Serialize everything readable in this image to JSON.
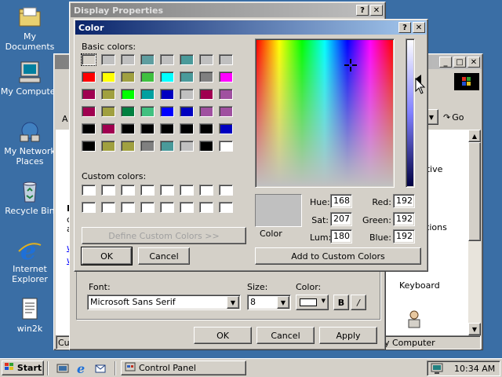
{
  "desktop": {
    "icons": [
      {
        "label": "My Documents",
        "icon": "folder-documents-icon"
      },
      {
        "label": "My Computer",
        "icon": "computer-icon"
      },
      {
        "label": "My Network Places",
        "icon": "network-places-icon"
      },
      {
        "label": "Recycle Bin",
        "icon": "recycle-bin-icon"
      },
      {
        "label": "Internet Explorer",
        "icon": "internet-explorer-icon"
      },
      {
        "label": "win2k",
        "icon": "text-document-icon"
      }
    ]
  },
  "control_panel": {
    "go_label": "Go",
    "address_prefix": "A",
    "right_items": [
      "ative",
      "ctions",
      "Keyboard"
    ],
    "status_left": "Cus",
    "status_right": "y Computer",
    "left_text": [
      "D",
      "c",
      "a",
      "w",
      "w"
    ]
  },
  "display_properties": {
    "title": "Display Properties",
    "font_label": "Font:",
    "font_value": "Microsoft Sans Serif",
    "size_label": "Size:",
    "size_value": "8",
    "color_label": "Color:",
    "bold_label": "B",
    "italic_label": "/",
    "ok_label": "OK",
    "cancel_label": "Cancel",
    "apply_label": "Apply"
  },
  "color_dialog": {
    "title": "Color",
    "basic_colors_label": "Basic colors:",
    "custom_colors_label": "Custom colors:",
    "define_custom_label": "Define Custom Colors >>",
    "ok_label": "OK",
    "cancel_label": "Cancel",
    "color_preview_label": "Color",
    "add_custom_label": "Add to Custom Colors",
    "hue_label": "Hue:",
    "sat_label": "Sat:",
    "lum_label": "Lum:",
    "red_label": "Red:",
    "green_label": "Green:",
    "blue_label": "Blue:",
    "hue_value": "168",
    "sat_value": "207",
    "lum_value": "180",
    "red_value": "192",
    "green_value": "192",
    "blue_value": "192",
    "preview_color": "#c0c0c0",
    "basic_colors": [
      "#d4d0c8",
      "#c0c0c0",
      "#c0c0c0",
      "#5f9ea0",
      "#c0c0c0",
      "#4a9a9a",
      "#c0c0c0",
      "#c0c0c0",
      "#ff0000",
      "#ffff00",
      "#a0a040",
      "#40c040",
      "#00ffff",
      "#4a9a9a",
      "#808080",
      "#ff00ff",
      "#a00050",
      "#a0a040",
      "#00ff00",
      "#00a0a0",
      "#0000c0",
      "#c0c0c0",
      "#a00050",
      "#a050a0",
      "#a00050",
      "#a0a040",
      "#008040",
      "#40c080",
      "#0000ff",
      "#0000c0",
      "#a050a0",
      "#a050a0",
      "#000000",
      "#a00050",
      "#000000",
      "#000000",
      "#000000",
      "#000000",
      "#000000",
      "#0000c0",
      "#000000",
      "#a0a040",
      "#a0a040",
      "#808080",
      "#4a9a9a",
      "#c0c0c0",
      "#000000",
      "#ffffff"
    ]
  },
  "taskbar": {
    "start_label": "Start",
    "task_label": "Control Panel",
    "clock": "10:34 AM"
  }
}
